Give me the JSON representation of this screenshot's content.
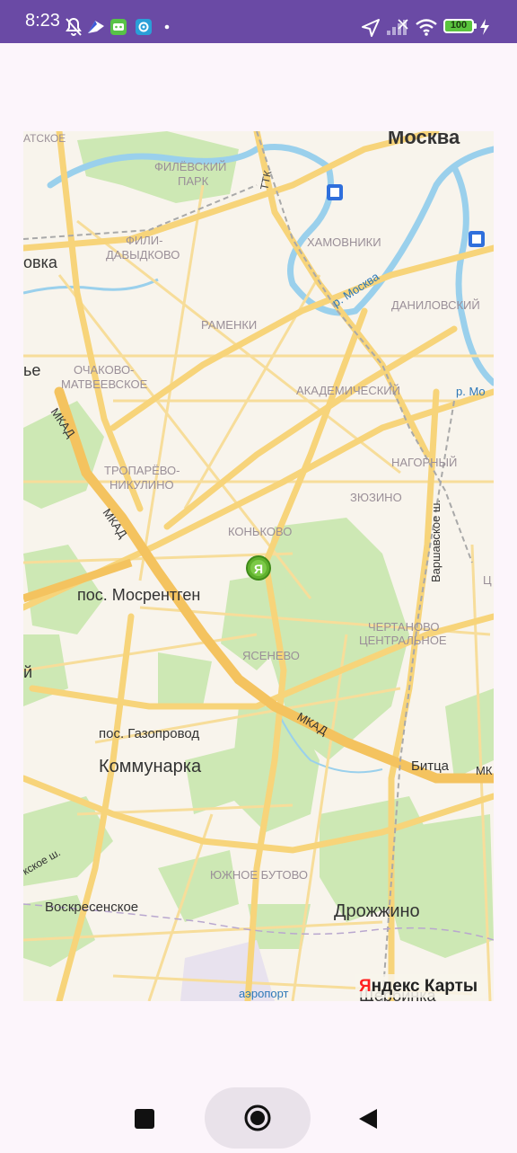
{
  "status_bar": {
    "time": "8:23",
    "battery": "100",
    "icons": [
      "bell-off-icon",
      "maps-app-icon",
      "robot-app-icon",
      "camera-app-icon",
      "dot-icon",
      "location-arrow-icon",
      "signal-icon",
      "wifi-icon",
      "battery-icon",
      "charging-icon"
    ]
  },
  "map": {
    "brand": {
      "prefix": "Я",
      "rest": "ндекс Карты"
    },
    "colors": {
      "background": "#f8f4ec",
      "forest": "#cde8b4",
      "road": "#f7d47a",
      "river": "#9ad0ec",
      "marker": "#5fb02d"
    },
    "labels": {
      "moskva": "Москва",
      "filevsky_park_1": "ФИЛЁВСКИЙ",
      "filevsky_park_2": "ПАРК",
      "ttk": "ТТК",
      "fili_1": "ФИЛИ-",
      "fili_2": "ДАВЫДКОВО",
      "khamovniki": "ХАМОВНИКИ",
      "river_moskva": "р. Москва",
      "danilovsky": "ДАНИЛОВСКИЙ",
      "ramenki": "РАМЕНКИ",
      "ochakovo_1": "ОЧАКОВО-",
      "ochakovo_2": "МАТВЕЕВСКОЕ",
      "akademichesky": "АКАДЕМИЧЕСКИЙ",
      "r_mo": "р. Мо",
      "mkad_1": "МКАД",
      "mkad_2": "МКАД",
      "mkad_3": "МКАД",
      "troparevo_1": "ТРОПАРЁВО-",
      "troparevo_2": "НИКУЛИНО",
      "nagorny": "НАГОРНЫЙ",
      "zyuzino": "ЗЮЗИНО",
      "konkovo": "КОНЬКОВО",
      "varshavskoe": "Варшавское ш.",
      "mosrentgen": "пос. Мосрентген",
      "chertanovo_1": "ЧЕРТАНОВО",
      "chertanovo_2": "ЦЕНТРАЛЬНОЕ",
      "yasenevo": "ЯСЕНЕВО",
      "gazoprovod": "пос. Газопровод",
      "kommunarka": "Коммунарка",
      "bitsa": "Битца",
      "mk_right": "МК",
      "yuzhnoe_butovo": "ЮЖНОЕ БУТОВО",
      "kievskoe": "кское ш.",
      "voskresenskoe": "Воскресенское",
      "drozhzhino": "Дрожжино",
      "aeroport": "аэропорт",
      "shcherbinka": "Щербинка",
      "ovka": "овка",
      "atskoe": "АТСКОЕ",
      "ye": "ье",
      "ts": "Ц",
      "marker_letter": "Я"
    }
  },
  "nav_bar": {
    "buttons": [
      "recents-button",
      "home-button",
      "back-button"
    ]
  }
}
